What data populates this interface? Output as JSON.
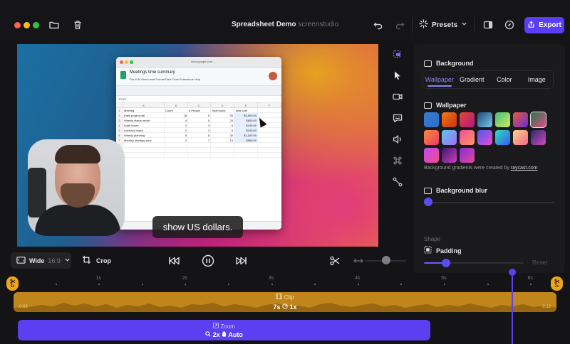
{
  "window": {
    "title_bold": "Spreadsheet Demo",
    "title_dim": "screenstudio",
    "presets_label": "Presets",
    "export_label": "Export"
  },
  "preview": {
    "sheet": {
      "url": "docs.google.com",
      "doc_title": "Meetings time summary",
      "menu": "File  Edit  View  Insert  Format  Data  Tools  Extensions  Help",
      "cell_ref": "E2:E7",
      "columns": [
        "",
        "A",
        "B",
        "C",
        "D",
        "E",
        "F"
      ],
      "rows": [
        [
          "1",
          "Meeting",
          "Count",
          "# People",
          "Total hours",
          "Total cost",
          ""
        ],
        [
          "2",
          "Daily project call",
          "18",
          "5",
          "90",
          "$3,600.00",
          ""
        ],
        [
          "3",
          "Weekly status report",
          "4",
          "5",
          "20",
          "$800.00",
          ""
        ],
        [
          "4",
          "Audit board",
          "2",
          "3",
          "6",
          "$240.00",
          ""
        ],
        [
          "5",
          "Advisory board",
          "2",
          "3",
          "6",
          "$240.00",
          ""
        ],
        [
          "6",
          "Weekly planning",
          "5",
          "6",
          "30",
          "$1,200.00",
          ""
        ],
        [
          "7",
          "Monthly strategy sync",
          "2",
          "7",
          "14",
          "$560.00",
          ""
        ],
        [
          "8",
          "",
          "",
          "",
          "",
          "",
          ""
        ],
        [
          "9",
          "",
          "",
          "",
          "",
          "",
          ""
        ],
        [
          "10",
          "",
          "",
          "",
          "",
          "",
          ""
        ]
      ]
    },
    "caption": "show US dollars."
  },
  "controls": {
    "aspect_label": "Wide",
    "aspect_ratio": "16:9",
    "crop_label": "Crop"
  },
  "panel": {
    "background_heading": "Background",
    "tabs": [
      "Wallpaper",
      "Gradient",
      "Color",
      "Image"
    ],
    "active_tab": "Wallpaper",
    "wallpaper_heading": "Wallpaper",
    "credit_text": "Background gradients were created by",
    "credit_link": "raycast.com",
    "blur_heading": "Background blur",
    "blur_value": 0.0,
    "shape_label": "Shape",
    "padding_heading": "Padding",
    "padding_value": 0.22,
    "reset_label": "Reset",
    "swatch_colors": [
      [
        "#3a7bd5",
        "#2a6fc9"
      ],
      [
        "#f07a1a",
        "#c9320f"
      ],
      [
        "#e04a2a",
        "#b0168a"
      ],
      [
        "#1a4a7a",
        "#7fc8e8"
      ],
      [
        "#3fbf7f",
        "#d8e85a"
      ],
      [
        "#e85a3a",
        "#6a2ad8"
      ],
      [
        "#1f7a4a",
        "#e84a8a"
      ],
      [
        "#ff8a3a",
        "#e83a6a"
      ],
      [
        "#5ac8f0",
        "#a76af0"
      ],
      [
        "#f04aa0",
        "#ff9a5a"
      ],
      [
        "#4a5af0",
        "#f04ad0"
      ],
      [
        "#2ae0c0",
        "#3a5af0"
      ],
      [
        "#ffd08a",
        "#f06a8a"
      ],
      [
        "#2a2a6a",
        "#d04ac0"
      ],
      [
        "#c04af0",
        "#f04a8a"
      ],
      [
        "#3a1a6a",
        "#d03ac0"
      ],
      [
        "#8a2ad8",
        "#e04a9a"
      ]
    ],
    "active_swatch": 6
  },
  "timeline": {
    "ruler_labels": [
      "1s",
      "2s",
      "3s",
      "4s",
      "5s",
      "6s"
    ],
    "start_marker": "5s",
    "end_marker": "2s",
    "clip_label": "Clip",
    "clip_duration": "7s",
    "clip_speed": "1x",
    "clip_time_start": "0:03",
    "clip_time_end": "0:12",
    "zoom_label": "Zoom",
    "zoom_level": "2x",
    "zoom_mode": "Auto"
  }
}
